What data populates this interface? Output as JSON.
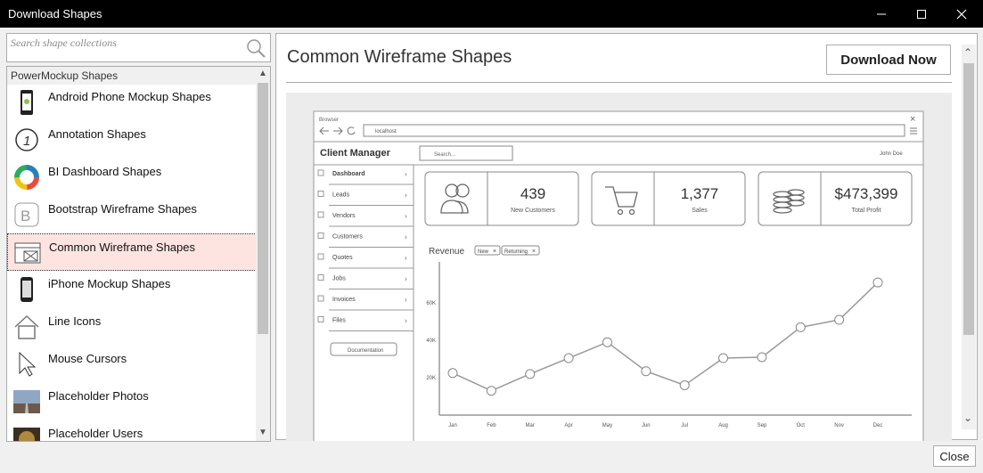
{
  "window": {
    "title": "Download Shapes",
    "min_icon": "minimize-icon",
    "max_icon": "maximize-icon",
    "close_icon": "close-icon"
  },
  "search": {
    "placeholder": "Search shape collections"
  },
  "collections": {
    "group": "PowerMockup Shapes",
    "selected_index": 4,
    "items": [
      {
        "label": "Android Phone Mockup Shapes",
        "icon": "android-phone-icon"
      },
      {
        "label": "Annotation Shapes",
        "icon": "annotation-icon"
      },
      {
        "label": "BI Dashboard Shapes",
        "icon": "donut-chart-icon"
      },
      {
        "label": "Bootstrap Wireframe Shapes",
        "icon": "bootstrap-icon"
      },
      {
        "label": "Common Wireframe Shapes",
        "icon": "wireframe-icon"
      },
      {
        "label": "iPhone Mockup Shapes",
        "icon": "iphone-icon"
      },
      {
        "label": "Line Icons",
        "icon": "home-icon"
      },
      {
        "label": "Mouse Cursors",
        "icon": "cursor-icon"
      },
      {
        "label": "Placeholder Photos",
        "icon": "photo-icon"
      },
      {
        "label": "Placeholder Users",
        "icon": "user-photo-icon"
      }
    ]
  },
  "detail": {
    "title": "Common Wireframe Shapes",
    "download_label": "Download Now"
  },
  "preview": {
    "browser_label": "Browser",
    "url": "localhost",
    "app_title": "Client Manager",
    "search_placeholder": "Search...",
    "user": "John Doe",
    "nav": [
      "Dashboard",
      "Leads",
      "Vendors",
      "Customers",
      "Quotes",
      "Jobs",
      "Invoices",
      "Files"
    ],
    "documentation": "Documentation",
    "stats": [
      {
        "value": "439",
        "label": "New Customers",
        "icon": "users-icon"
      },
      {
        "value": "1,377",
        "label": "Sales",
        "icon": "cart-icon"
      },
      {
        "value": "$473,399",
        "label": "Total Profit",
        "icon": "coins-icon"
      }
    ],
    "revenue_label": "Revenue",
    "tags": [
      "New",
      "Returning"
    ]
  },
  "chart_data": {
    "type": "line",
    "categories": [
      "Jan",
      "Feb",
      "Mar",
      "Apr",
      "May",
      "Jun",
      "Jul",
      "Aug",
      "Sep",
      "Oct",
      "Nov",
      "Dec"
    ],
    "values": [
      22500,
      13000,
      22000,
      30500,
      39000,
      23500,
      16000,
      30500,
      31000,
      47000,
      51000,
      71000
    ],
    "yticks": [
      "20K",
      "40K",
      "60K"
    ],
    "ylim": [
      0,
      82000
    ]
  },
  "footer": {
    "close_label": "Close"
  }
}
